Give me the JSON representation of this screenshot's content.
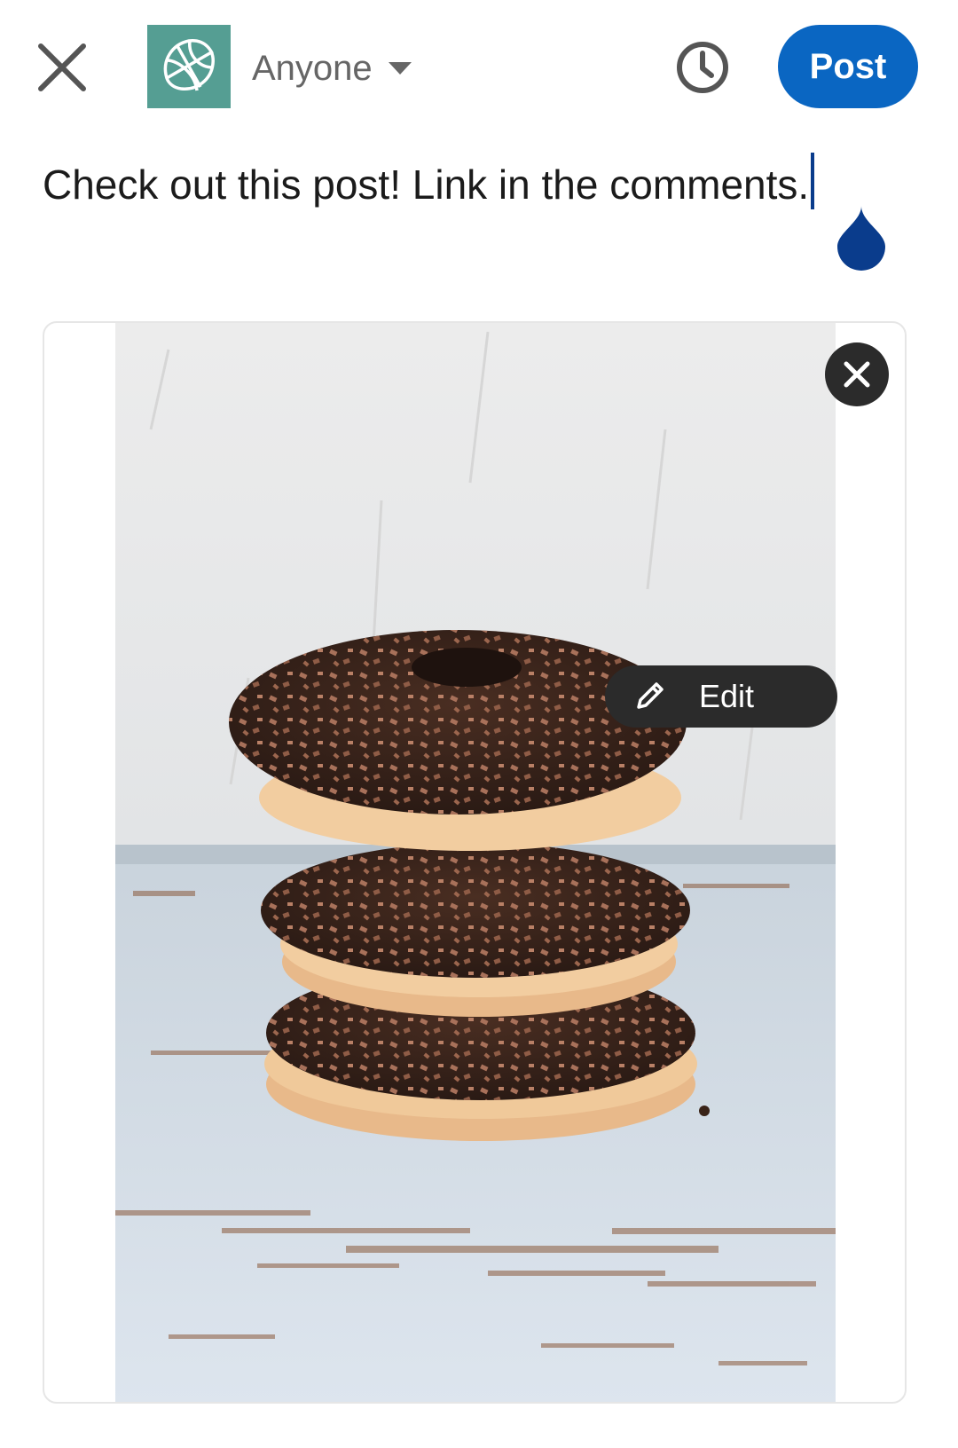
{
  "header": {
    "audience_label": "Anyone",
    "post_label": "Post"
  },
  "composer": {
    "text": "Check out this post! Link in the comments."
  },
  "media": {
    "edit_label": "Edit"
  },
  "colors": {
    "brand_blue": "#0a66c2",
    "avatar_teal": "#559e93",
    "pill_dark": "#2b2b2b"
  }
}
